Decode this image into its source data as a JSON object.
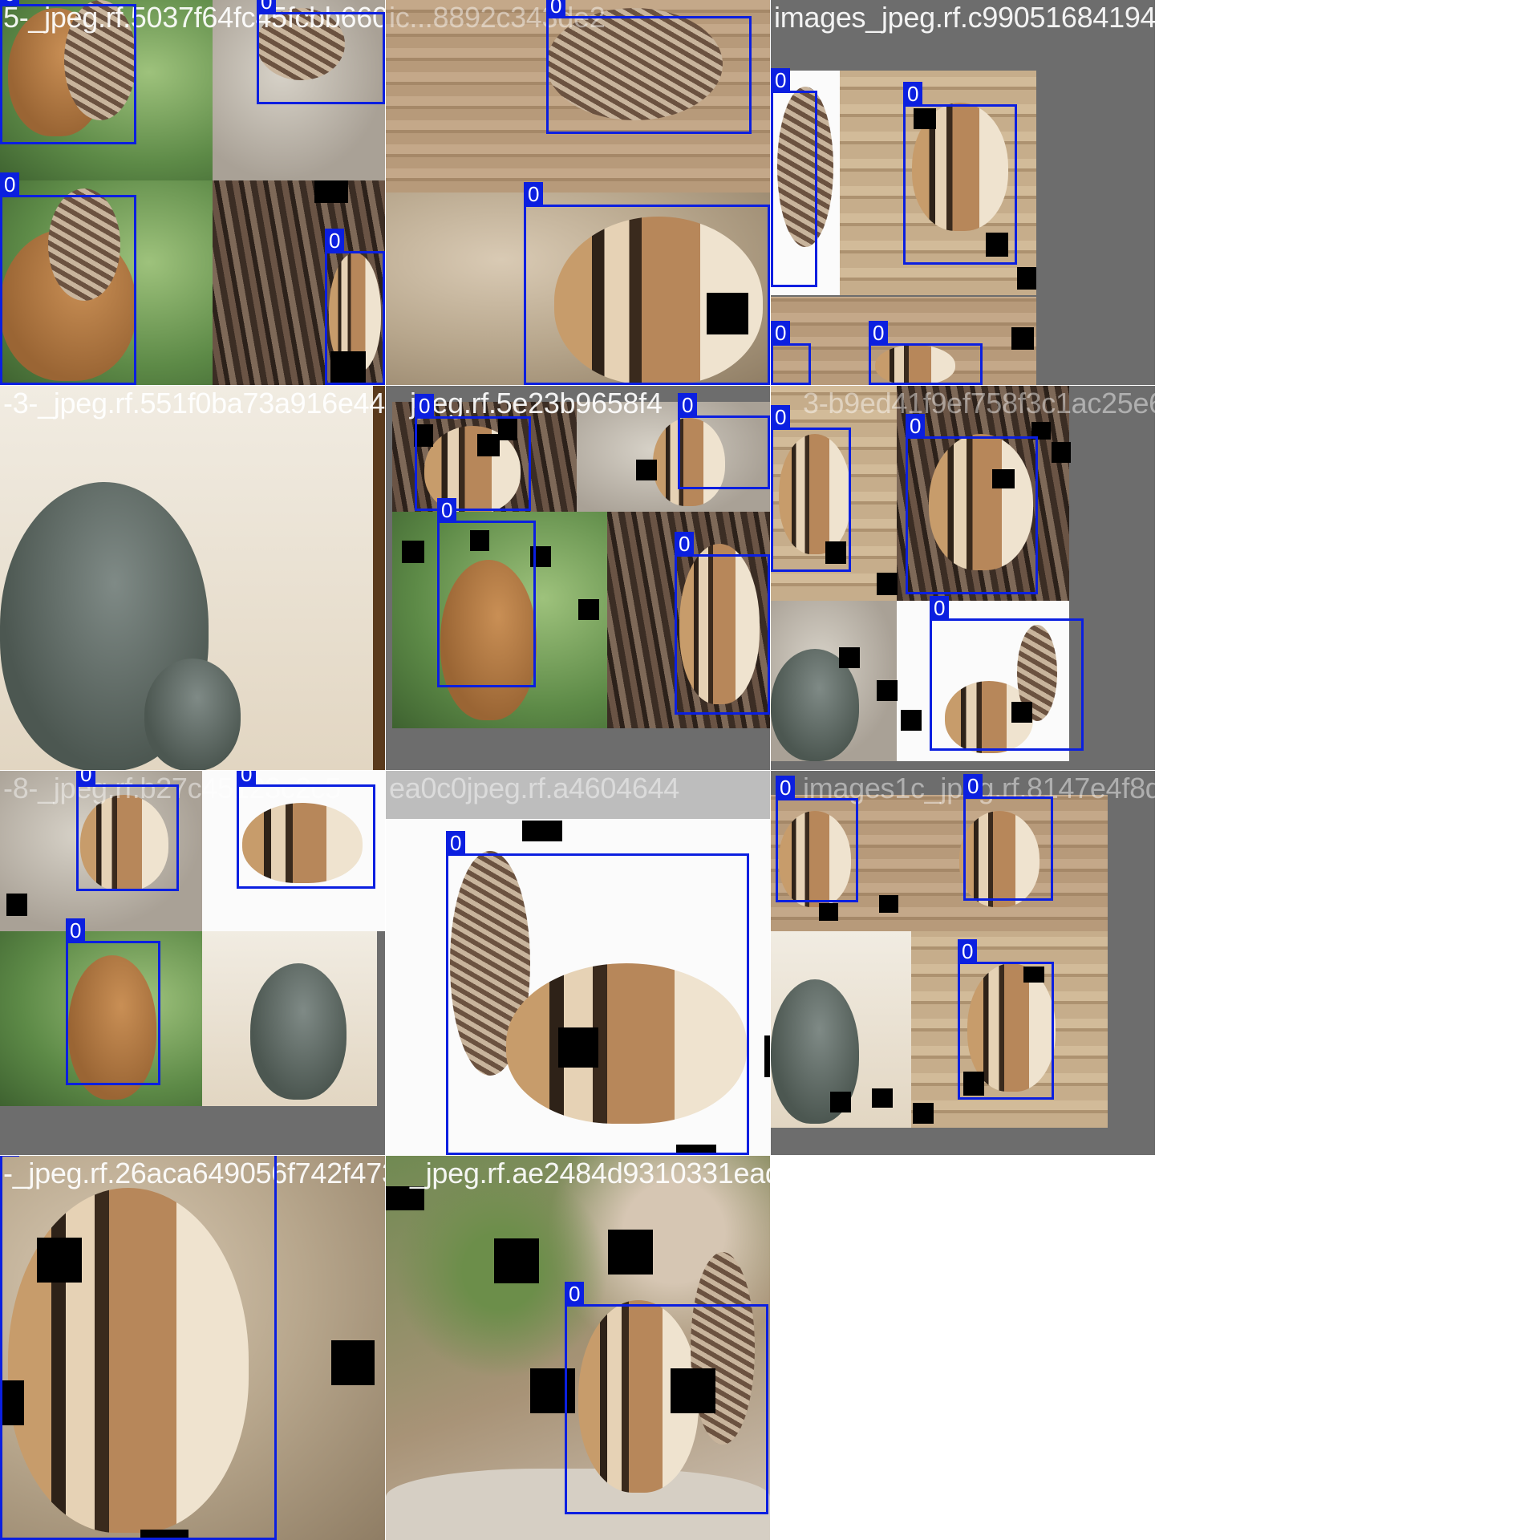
{
  "mosaic": {
    "box_class_label": "0",
    "box_color": "#0b1fe0",
    "tiles": [
      {
        "id": "tile-1",
        "filename": "5-_jpeg.rf.5037f64fc45fcbb6607afe0ca1d892c343de2"
      },
      {
        "id": "tile-2",
        "filename": "ic...8892c343de2"
      },
      {
        "id": "tile-3",
        "filename": "images_jpeg.rf.c99051684194b57489a7c75e140"
      },
      {
        "id": "tile-4",
        "filename": "-3-_jpeg.rf.551f0ba73a916e44ba3835f28d05e23b9658f4"
      },
      {
        "id": "tile-5",
        "filename": "jpeg.rf.5e23b9658f4"
      },
      {
        "id": "tile-6",
        "filename": "3-b9ed41f9ef758f3c1ac25e6d225e4262d7e"
      },
      {
        "id": "tile-7",
        "filename": "-8-_jpeg.rf.b27c45123c2c5"
      },
      {
        "id": "tile-8",
        "filename": "ea0c0jpeg.rf.a4604644"
      },
      {
        "id": "tile-9",
        "filename": "images1c_jpeg.rf.8147e4f8da39768816e72c"
      },
      {
        "id": "tile-10",
        "filename": "-_jpeg.rf.26aca649056f742f473755af6e2484d9310331ead96977426ff5ca"
      },
      {
        "id": "tile-11",
        "filename": "_jpeg.rf.ae2484d9310331ead96977426ff5ca"
      }
    ]
  }
}
